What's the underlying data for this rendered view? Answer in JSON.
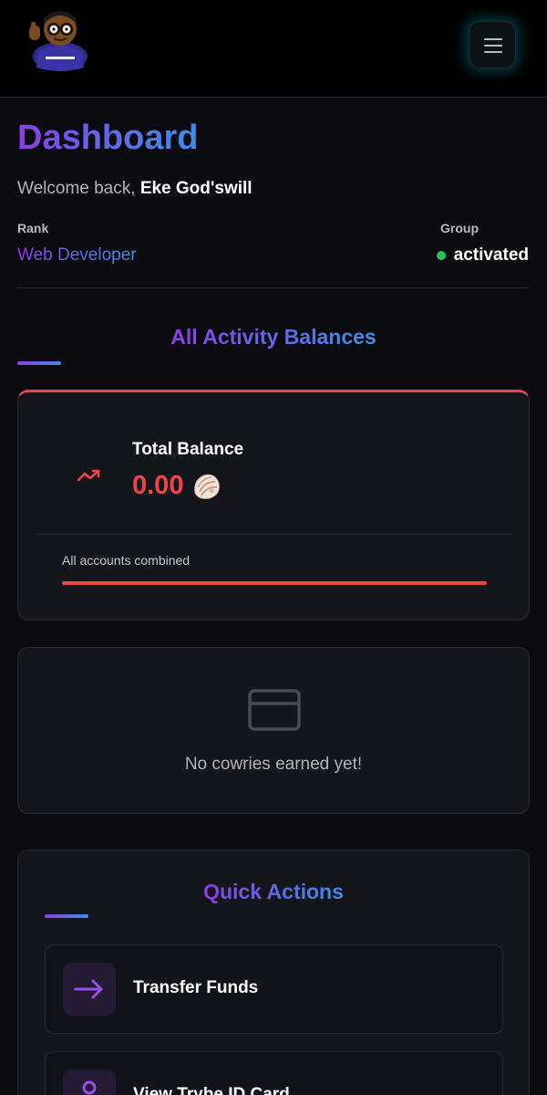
{
  "header": {
    "avatar_icon": "cartoon-avatar-icon",
    "menu_icon": "hamburger-menu-icon"
  },
  "page": {
    "title": "Dashboard",
    "welcome_prefix": "Welcome back,",
    "user_name": "Eke God'swill",
    "rank_label": "Rank",
    "rank_value": "Web Developer",
    "group_label": "Group",
    "group_value": "activated",
    "group_status_color": "#22c55e"
  },
  "balances": {
    "section_title": "All Activity Balances",
    "total_label": "Total Balance",
    "total_amount": "0.00",
    "currency_icon": "cowrie-shell-icon",
    "trend_icon": "trending-down-icon",
    "note": "All accounts combined",
    "accent_color": "#ef4444"
  },
  "empty_state": {
    "icon": "credit-card-icon",
    "message": "No cowries earned yet!"
  },
  "quick_actions": {
    "title": "Quick Actions",
    "items": [
      {
        "label": "Transfer Funds",
        "icon": "arrow-right-icon"
      },
      {
        "label": "View Trybe ID Card",
        "icon": "user-icon"
      }
    ]
  },
  "colors": {
    "gradient_start": "#8b3ee6",
    "gradient_end": "#3b8fe8",
    "background": "#0c0c10",
    "card": "#15151c"
  }
}
